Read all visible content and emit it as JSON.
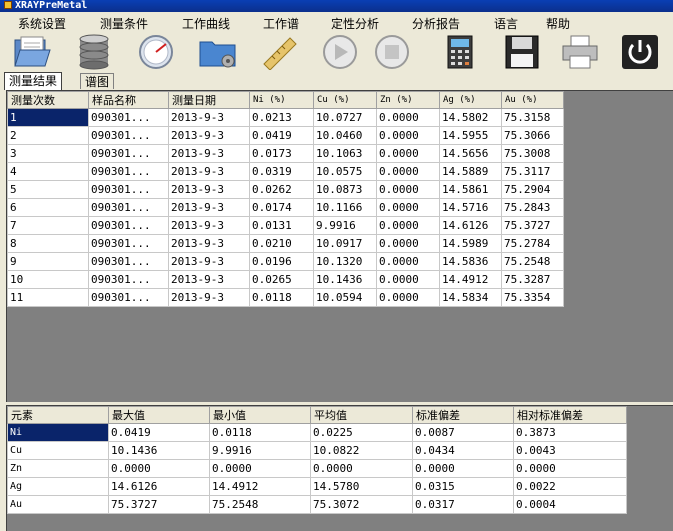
{
  "window": {
    "title": "XRAYPreMetal"
  },
  "menu": [
    "系统设置",
    "测量条件",
    "工作曲线",
    "工作谱",
    "定性分析",
    "分析报告",
    "语言",
    "帮助"
  ],
  "toolbar": [
    {
      "name": "open-folder-icon"
    },
    {
      "name": "database-icon"
    },
    {
      "name": "gauge-icon"
    },
    {
      "name": "settings-folder-icon"
    },
    {
      "name": "ruler-icon"
    },
    {
      "name": "play-icon"
    },
    {
      "name": "stop-icon"
    },
    {
      "name": "calculator-icon"
    },
    {
      "name": "save-icon"
    },
    {
      "name": "printer-icon"
    },
    {
      "name": "power-icon"
    }
  ],
  "tabs": [
    "测量结果",
    "谱图"
  ],
  "results": {
    "columns": [
      "测量次数",
      "样品名称",
      "测量日期",
      "Ni (%)",
      "Cu (%)",
      "Zn (%)",
      "Ag (%)",
      "Au (%)"
    ],
    "rows": [
      [
        "1",
        "090301...",
        "2013-9-3",
        "0.0213",
        "10.0727",
        "0.0000",
        "14.5802",
        "75.3158"
      ],
      [
        "2",
        "090301...",
        "2013-9-3",
        "0.0419",
        "10.0460",
        "0.0000",
        "14.5955",
        "75.3066"
      ],
      [
        "3",
        "090301...",
        "2013-9-3",
        "0.0173",
        "10.1063",
        "0.0000",
        "14.5656",
        "75.3008"
      ],
      [
        "4",
        "090301...",
        "2013-9-3",
        "0.0319",
        "10.0575",
        "0.0000",
        "14.5889",
        "75.3117"
      ],
      [
        "5",
        "090301...",
        "2013-9-3",
        "0.0262",
        "10.0873",
        "0.0000",
        "14.5861",
        "75.2904"
      ],
      [
        "6",
        "090301...",
        "2013-9-3",
        "0.0174",
        "10.1166",
        "0.0000",
        "14.5716",
        "75.2843"
      ],
      [
        "7",
        "090301...",
        "2013-9-3",
        "0.0131",
        "9.9916",
        "0.0000",
        "14.6126",
        "75.3727"
      ],
      [
        "8",
        "090301...",
        "2013-9-3",
        "0.0210",
        "10.0917",
        "0.0000",
        "14.5989",
        "75.2784"
      ],
      [
        "9",
        "090301...",
        "2013-9-3",
        "0.0196",
        "10.1320",
        "0.0000",
        "14.5836",
        "75.2548"
      ],
      [
        "10",
        "090301...",
        "2013-9-3",
        "0.0265",
        "10.1436",
        "0.0000",
        "14.4912",
        "75.3287"
      ],
      [
        "11",
        "090301...",
        "2013-9-3",
        "0.0118",
        "10.0594",
        "0.0000",
        "14.5834",
        "75.3354"
      ]
    ]
  },
  "stats": {
    "columns": [
      "元素",
      "最大值",
      "最小值",
      "平均值",
      "标准偏差",
      "相对标准偏差"
    ],
    "rows": [
      [
        "Ni",
        "0.0419",
        "0.0118",
        "0.0225",
        "0.0087",
        "0.3873"
      ],
      [
        "Cu",
        "10.1436",
        "9.9916",
        "10.0822",
        "0.0434",
        "0.0043"
      ],
      [
        "Zn",
        "0.0000",
        "0.0000",
        "0.0000",
        "0.0000",
        "0.0000"
      ],
      [
        "Ag",
        "14.6126",
        "14.4912",
        "14.5780",
        "0.0315",
        "0.0022"
      ],
      [
        "Au",
        "75.3727",
        "75.2548",
        "75.3072",
        "0.0317",
        "0.0004"
      ]
    ]
  },
  "colors": {
    "titlebar": "#0a3fb4",
    "selection": "#0a246a",
    "panel_bg": "#808080",
    "chrome": "#ece9d8"
  }
}
